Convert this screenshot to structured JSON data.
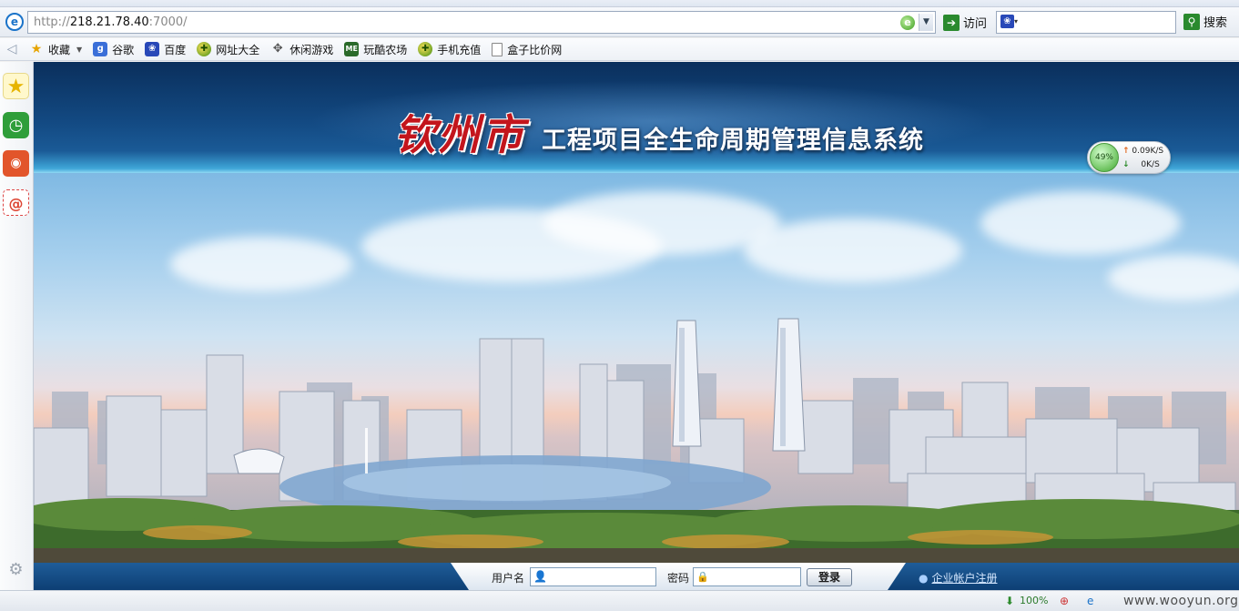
{
  "browser": {
    "address": {
      "scheme": "http://",
      "host": "218.21.78.40",
      "port_path": ":7000/"
    },
    "go_label": "访问",
    "search_label": "搜索",
    "favorites": [
      {
        "label": "收藏",
        "icon": "star-icon"
      },
      {
        "label": "谷歌",
        "icon": "google-icon"
      },
      {
        "label": "百度",
        "icon": "baidu-paw-icon"
      },
      {
        "label": "网址大全",
        "icon": "site-nav-icon"
      },
      {
        "label": "休闲游戏",
        "icon": "gamepad-icon"
      },
      {
        "label": "玩酷农场",
        "icon": "me-icon"
      },
      {
        "label": "手机充值",
        "icon": "recharge-icon"
      },
      {
        "label": "盒子比价网",
        "icon": "page-icon"
      }
    ],
    "speed": {
      "percent": "49%",
      "up": "0.09K/S",
      "down": "0K/S"
    },
    "status": {
      "zoom_left": "100%",
      "watermark": "www.wooyun.org"
    }
  },
  "page": {
    "city_name": "钦州市",
    "system_title": "工程项目全生命周期管理信息系统",
    "login": {
      "username_label": "用户名",
      "password_label": "密码",
      "login_button": "登录",
      "register_link": "企业帐户注册"
    }
  },
  "colors": {
    "header_blue": "#134a83",
    "city_red": "#c3151c",
    "login_bar": "#0d3f74"
  }
}
